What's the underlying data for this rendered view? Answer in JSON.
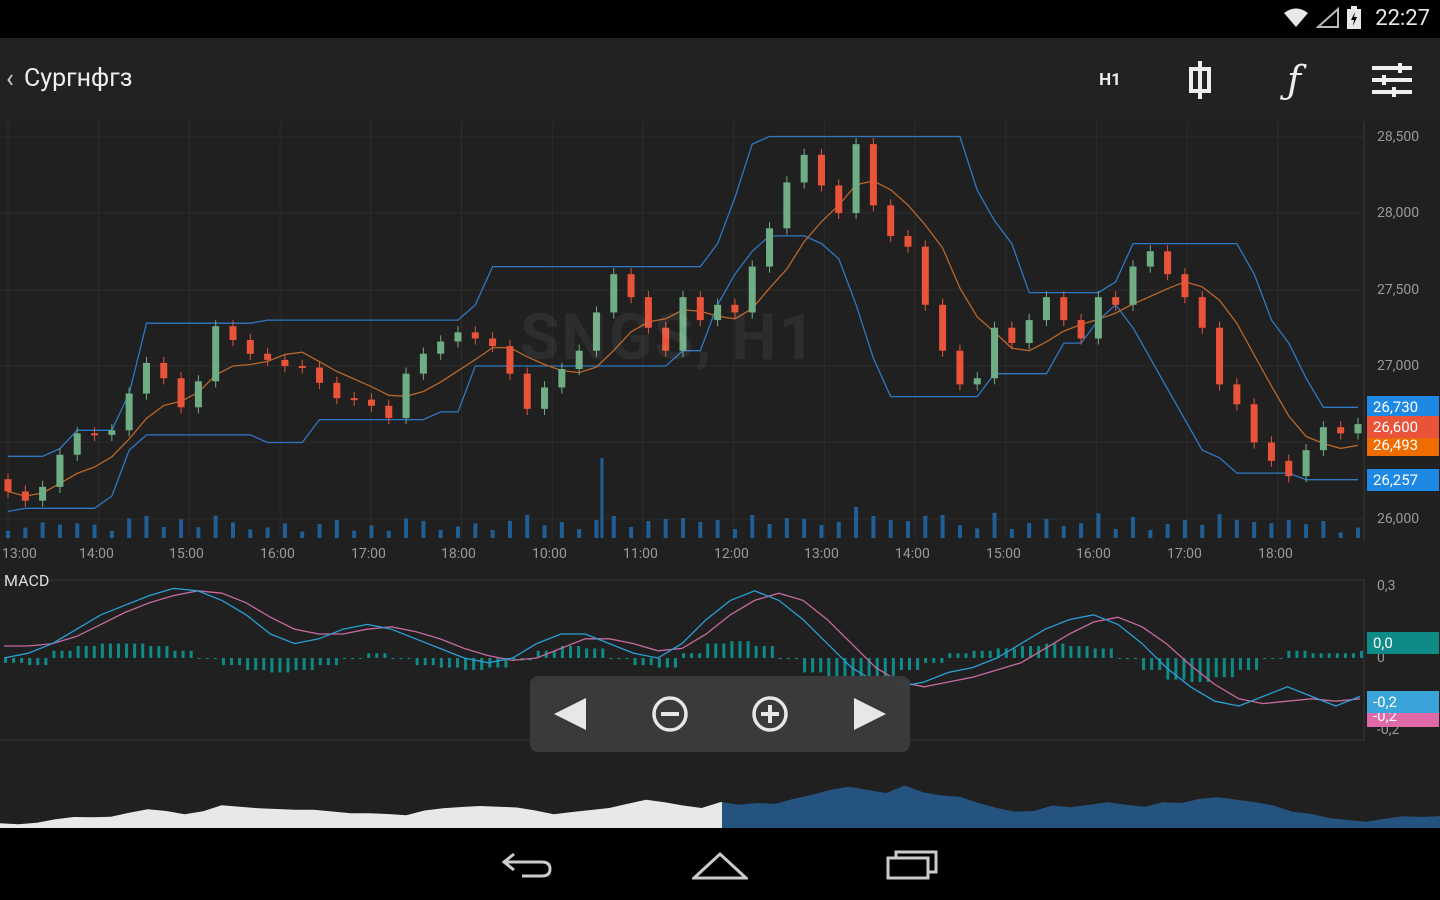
{
  "status_bar": {
    "clock": "22:27",
    "icons": [
      "wifi-icon",
      "signal-icon",
      "battery-charging-icon"
    ]
  },
  "header": {
    "back_icon": "chevron-left-icon",
    "title": "Сургнфгз",
    "timeframe": "H1",
    "chart_type_icon": "candlestick-icon",
    "indicators_icon": "function-icon",
    "settings_icon": "sliders-icon"
  },
  "watermark": "SNGS, H1",
  "macd_label": "MACD",
  "price_axis": {
    "ticks": [
      "28,500",
      "28,000",
      "27,500",
      "27,000",
      "26,000"
    ]
  },
  "time_axis": {
    "ticks": [
      "13:00",
      "14:00",
      "15:00",
      "16:00",
      "17:00",
      "18:00",
      "10:00",
      "11:00",
      "12:00",
      "13:00",
      "14:00",
      "15:00",
      "16:00",
      "17:00",
      "18:00"
    ]
  },
  "price_tags": [
    {
      "label": "26,730",
      "color": "#1e88e5"
    },
    {
      "label": "26,600",
      "color": "#e8533a"
    },
    {
      "label": "26,493",
      "color": "#ef6c00"
    },
    {
      "label": "26,257",
      "color": "#1e88e5"
    }
  ],
  "macd_axis": {
    "ticks": [
      "0,3",
      "0",
      "-0,2"
    ]
  },
  "macd_tags": [
    {
      "label": "0,0",
      "color": "#0e8a87"
    },
    {
      "label": "-0,2",
      "color": "#3aa3d9"
    },
    {
      "label": "-0,2",
      "color": "#e06aa8"
    }
  ],
  "nav_controls": {
    "prev_icon": "triangle-left-icon",
    "zoom_out_icon": "zoom-out-icon",
    "zoom_in_icon": "zoom-in-icon",
    "next_icon": "triangle-right-icon"
  },
  "system_nav": {
    "back_icon": "back-arrow-icon",
    "home_icon": "home-icon",
    "recents_icon": "recents-icon"
  },
  "colors": {
    "up": "#6fae84",
    "down": "#e8533a",
    "band": "#2e78c4",
    "mid": "#b8672a",
    "volume": "#1f5f96",
    "macd": "#2a9fd6",
    "signal": "#c76a9e",
    "hist": "#0e8a87",
    "navigator": "#24537f"
  },
  "chart_data": {
    "type": "candlestick",
    "price_range": [
      26000,
      28500
    ],
    "candles": [
      {
        "t": "13:00",
        "o": 26260,
        "c": 26180
      },
      {
        "t": "13:15",
        "o": 26180,
        "c": 26120
      },
      {
        "t": "13:30",
        "o": 26120,
        "c": 26210
      },
      {
        "t": "13:45",
        "o": 26210,
        "c": 26420
      },
      {
        "t": "14:00",
        "o": 26420,
        "c": 26560
      },
      {
        "t": "14:15",
        "o": 26560,
        "c": 26550
      },
      {
        "t": "14:30",
        "o": 26550,
        "c": 26580
      },
      {
        "t": "14:45",
        "o": 26580,
        "c": 26820
      },
      {
        "t": "15:00",
        "o": 26820,
        "c": 27020
      },
      {
        "t": "15:15",
        "o": 27020,
        "c": 26920
      },
      {
        "t": "15:30",
        "o": 26920,
        "c": 26730
      },
      {
        "t": "15:45",
        "o": 26730,
        "c": 26900
      },
      {
        "t": "16:00",
        "o": 26900,
        "c": 27260
      },
      {
        "t": "16:15",
        "o": 27260,
        "c": 27170
      },
      {
        "t": "16:30",
        "o": 27170,
        "c": 27080
      },
      {
        "t": "16:45",
        "o": 27080,
        "c": 27040
      },
      {
        "t": "17:00",
        "o": 27040,
        "c": 27000
      },
      {
        "t": "17:15",
        "o": 27000,
        "c": 26990
      },
      {
        "t": "17:30",
        "o": 26990,
        "c": 26890
      },
      {
        "t": "17:45",
        "o": 26890,
        "c": 26790
      },
      {
        "t": "18:00",
        "o": 26790,
        "c": 26780
      },
      {
        "t": "18:15",
        "o": 26780,
        "c": 26740
      },
      {
        "t": "18:30",
        "o": 26740,
        "c": 26660
      },
      {
        "t": "18:45",
        "o": 26660,
        "c": 26950
      },
      {
        "t": "10:00",
        "o": 26950,
        "c": 27080
      },
      {
        "t": "10:15",
        "o": 27080,
        "c": 27160
      },
      {
        "t": "10:30",
        "o": 27160,
        "c": 27220
      },
      {
        "t": "10:45",
        "o": 27220,
        "c": 27180
      },
      {
        "t": "11:00",
        "o": 27180,
        "c": 27130
      },
      {
        "t": "11:15",
        "o": 27130,
        "c": 26950
      },
      {
        "t": "11:30",
        "o": 26950,
        "c": 26720
      },
      {
        "t": "11:45",
        "o": 26720,
        "c": 26860
      },
      {
        "t": "12:00",
        "o": 26860,
        "c": 26980
      },
      {
        "t": "12:15",
        "o": 26980,
        "c": 27100
      },
      {
        "t": "12:30",
        "o": 27100,
        "c": 27350
      },
      {
        "t": "12:45",
        "o": 27350,
        "c": 27600
      },
      {
        "t": "13:00",
        "o": 27600,
        "c": 27450
      },
      {
        "t": "13:15",
        "o": 27450,
        "c": 27250
      },
      {
        "t": "13:30",
        "o": 27250,
        "c": 27100
      },
      {
        "t": "13:45",
        "o": 27100,
        "c": 27450
      },
      {
        "t": "14:00",
        "o": 27450,
        "c": 27300
      },
      {
        "t": "14:15",
        "o": 27300,
        "c": 27400
      },
      {
        "t": "14:30",
        "o": 27400,
        "c": 27350
      },
      {
        "t": "14:45",
        "o": 27350,
        "c": 27650
      },
      {
        "t": "15:00",
        "o": 27650,
        "c": 27900
      },
      {
        "t": "15:15",
        "o": 27900,
        "c": 28200
      },
      {
        "t": "15:30",
        "o": 28200,
        "c": 28380
      },
      {
        "t": "15:45",
        "o": 28380,
        "c": 28180
      },
      {
        "t": "16:00",
        "o": 28180,
        "c": 28000
      },
      {
        "t": "16:15",
        "o": 28000,
        "c": 28450
      },
      {
        "t": "16:30",
        "o": 28450,
        "c": 28050
      },
      {
        "t": "16:45",
        "o": 28050,
        "c": 27850
      },
      {
        "t": "17:00",
        "o": 27850,
        "c": 27780
      },
      {
        "t": "17:15",
        "o": 27780,
        "c": 27400
      },
      {
        "t": "17:30",
        "o": 27400,
        "c": 27100
      },
      {
        "t": "17:45",
        "o": 27100,
        "c": 26880
      },
      {
        "t": "18:00",
        "o": 26880,
        "c": 26920
      },
      {
        "t": "18:15",
        "o": 26920,
        "c": 27250
      },
      {
        "t": "18:30",
        "o": 27250,
        "c": 27150
      },
      {
        "t": "18:45",
        "o": 27150,
        "c": 27300
      },
      {
        "t": "10:00",
        "o": 27300,
        "c": 27450
      },
      {
        "t": "10:15",
        "o": 27450,
        "c": 27300
      },
      {
        "t": "10:30",
        "o": 27300,
        "c": 27180
      },
      {
        "t": "10:45",
        "o": 27180,
        "c": 27450
      },
      {
        "t": "11:00",
        "o": 27450,
        "c": 27400
      },
      {
        "t": "11:15",
        "o": 27400,
        "c": 27650
      },
      {
        "t": "11:30",
        "o": 27650,
        "c": 27750
      },
      {
        "t": "11:45",
        "o": 27750,
        "c": 27600
      },
      {
        "t": "12:00",
        "o": 27600,
        "c": 27450
      },
      {
        "t": "12:15",
        "o": 27450,
        "c": 27250
      },
      {
        "t": "12:30",
        "o": 27250,
        "c": 26880
      },
      {
        "t": "12:45",
        "o": 26880,
        "c": 26750
      },
      {
        "t": "13:00",
        "o": 26750,
        "c": 26500
      },
      {
        "t": "13:15",
        "o": 26500,
        "c": 26380
      },
      {
        "t": "13:30",
        "o": 26380,
        "c": 26280
      },
      {
        "t": "13:45",
        "o": 26280,
        "c": 26450
      },
      {
        "t": "14:00",
        "o": 26450,
        "c": 26600
      },
      {
        "t": "14:15",
        "o": 26600,
        "c": 26560
      },
      {
        "t": "14:30",
        "o": 26560,
        "c": 26620
      }
    ],
    "upper_band": [
      26410,
      26410,
      26410,
      26460,
      26580,
      26580,
      26580,
      26820,
      27280,
      27280,
      27280,
      27280,
      27280,
      27280,
      27280,
      27300,
      27300,
      27300,
      27300,
      27300,
      27300,
      27300,
      27300,
      27300,
      27300,
      27300,
      27300,
      27400,
      27650,
      27650,
      27650,
      27650,
      27650,
      27650,
      27650,
      27650,
      27650,
      27650,
      27650,
      27650,
      27650,
      27800,
      28100,
      28450,
      28500,
      28500,
      28500,
      28500,
      28500,
      28500,
      28500,
      28500,
      28500,
      28500,
      28500,
      28500,
      28150,
      27950,
      27800,
      27480,
      27480,
      27480,
      27480,
      27480,
      27550,
      27800,
      27800,
      27800,
      27800,
      27800,
      27800,
      27800,
      27600,
      27300,
      27150,
      26920,
      26730,
      26730,
      26730
    ],
    "lower_band": [
      26050,
      26070,
      26070,
      26070,
      26070,
      26070,
      26150,
      26450,
      26550,
      26550,
      26550,
      26550,
      26550,
      26550,
      26550,
      26500,
      26500,
      26500,
      26650,
      26650,
      26650,
      26650,
      26650,
      26650,
      26650,
      26700,
      26700,
      27000,
      27000,
      27000,
      27000,
      27000,
      27000,
      27000,
      27000,
      27000,
      27000,
      27000,
      27000,
      27100,
      27100,
      27400,
      27600,
      27750,
      27850,
      27850,
      27850,
      27800,
      27700,
      27400,
      27050,
      26800,
      26800,
      26800,
      26800,
      26800,
      26800,
      26950,
      26950,
      26950,
      26950,
      27150,
      27150,
      27300,
      27400,
      27250,
      27050,
      26850,
      26650,
      26450,
      26400,
      26300,
      26300,
      26300,
      26300,
      26257,
      26257,
      26257,
      26257
    ],
    "macd": [
      0.0,
      0.02,
      0.06,
      0.12,
      0.18,
      0.22,
      0.26,
      0.29,
      0.28,
      0.24,
      0.18,
      0.1,
      0.06,
      0.08,
      0.12,
      0.14,
      0.12,
      0.08,
      0.04,
      0.0,
      -0.02,
      0.0,
      0.06,
      0.1,
      0.1,
      0.06,
      0.02,
      0.0,
      0.06,
      0.16,
      0.24,
      0.28,
      0.24,
      0.16,
      0.06,
      -0.04,
      -0.1,
      -0.12,
      -0.1,
      -0.06,
      -0.04,
      0.0,
      0.06,
      0.12,
      0.16,
      0.18,
      0.14,
      0.06,
      -0.04,
      -0.12,
      -0.18,
      -0.2,
      -0.16,
      -0.12,
      -0.16,
      -0.2,
      -0.16
    ],
    "signal": [
      0.05,
      0.05,
      0.06,
      0.09,
      0.14,
      0.19,
      0.23,
      0.26,
      0.28,
      0.27,
      0.23,
      0.17,
      0.12,
      0.1,
      0.1,
      0.12,
      0.13,
      0.11,
      0.08,
      0.04,
      0.01,
      -0.01,
      0.0,
      0.04,
      0.08,
      0.08,
      0.06,
      0.03,
      0.04,
      0.1,
      0.18,
      0.24,
      0.27,
      0.24,
      0.16,
      0.06,
      -0.04,
      -0.1,
      -0.12,
      -0.1,
      -0.08,
      -0.05,
      -0.02,
      0.04,
      0.1,
      0.15,
      0.17,
      0.13,
      0.06,
      -0.03,
      -0.11,
      -0.17,
      -0.19,
      -0.18,
      -0.17,
      -0.18,
      -0.17
    ],
    "histogram": [
      -0.02,
      -0.03,
      0.03,
      0.05,
      0.06,
      0.06,
      0.05,
      0.03,
      0.0,
      -0.03,
      -0.05,
      -0.06,
      -0.05,
      -0.03,
      0.0,
      0.02,
      0.0,
      -0.03,
      -0.04,
      -0.05,
      -0.04,
      -0.01,
      0.03,
      0.05,
      0.04,
      0.0,
      -0.03,
      -0.04,
      0.02,
      0.06,
      0.07,
      0.05,
      0.0,
      -0.06,
      -0.09,
      -0.1,
      -0.08,
      -0.05,
      -0.02,
      0.02,
      0.03,
      0.04,
      0.05,
      0.06,
      0.05,
      0.04,
      0.0,
      -0.05,
      -0.09,
      -0.1,
      -0.08,
      -0.05,
      0.0,
      0.03,
      0.02,
      0.02,
      0.03
    ]
  }
}
